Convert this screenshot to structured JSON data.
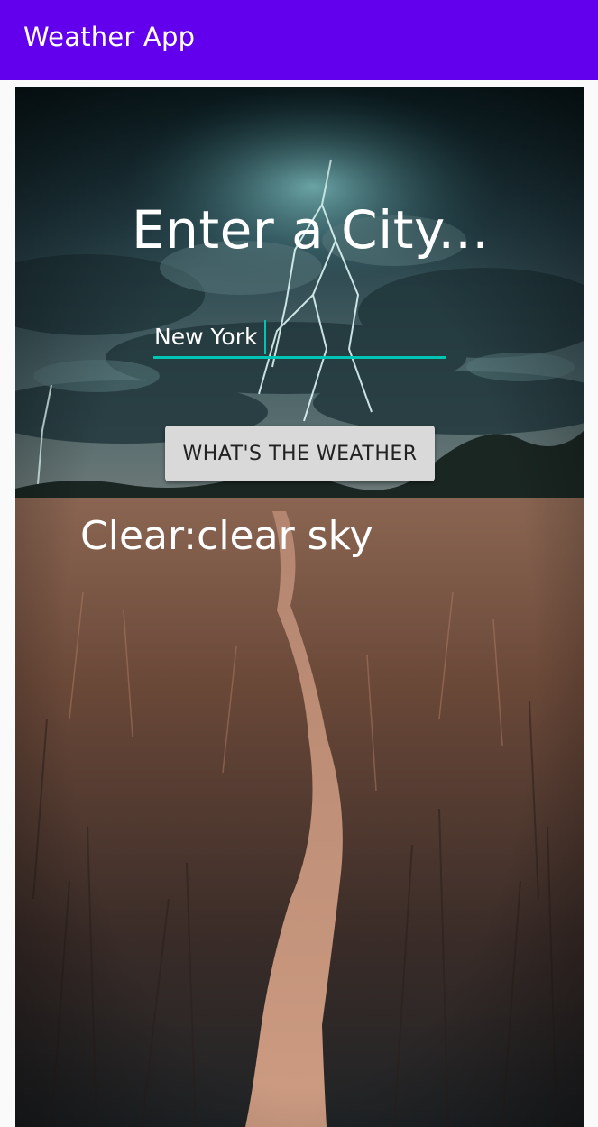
{
  "app_bar": {
    "title": "Weather App",
    "color": "#6200ee"
  },
  "main": {
    "heading": "Enter a City...",
    "city_input": {
      "value": "New York",
      "underline_color": "#00c4b4"
    },
    "button_label": "WHAT'S THE WEATHER",
    "result_text": "Clear:clear sky"
  },
  "background_image": {
    "description": "stormy sky with lightning over a grassy field path",
    "colors": {
      "sky_dark": "#0d2226",
      "sky_cloud": "#3e5a60",
      "field": "#7a5440",
      "path": "#d6a58a"
    }
  }
}
